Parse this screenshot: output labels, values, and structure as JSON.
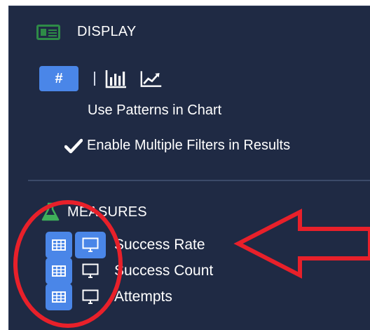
{
  "display": {
    "title": "DISPLAY",
    "icon": "newspaper-icon",
    "value_format_label": "#",
    "bar_chart_icon": "bar-chart-icon",
    "line_chart_icon": "line-chart-icon",
    "use_patterns_label": "Use Patterns in Chart",
    "enable_filters_label": "Enable Multiple Filters in Results",
    "enable_filters_checked": true
  },
  "measures": {
    "title": "MEASURES",
    "icon": "flask-icon",
    "items": [
      {
        "label": "Success Rate",
        "table_icon": "table-icon",
        "monitor_icon": "monitor-icon",
        "monitor_active": true
      },
      {
        "label": "Success Count",
        "table_icon": "table-icon",
        "monitor_icon": "monitor-icon",
        "monitor_active": false
      },
      {
        "label": "Attempts",
        "table_icon": "table-icon",
        "monitor_icon": "monitor-icon",
        "monitor_active": false
      }
    ]
  },
  "colors": {
    "panel_bg": "#1f2a44",
    "accent": "#4a86e8",
    "display_icon": "#2e8b47",
    "annotation_red": "#e8202a"
  }
}
